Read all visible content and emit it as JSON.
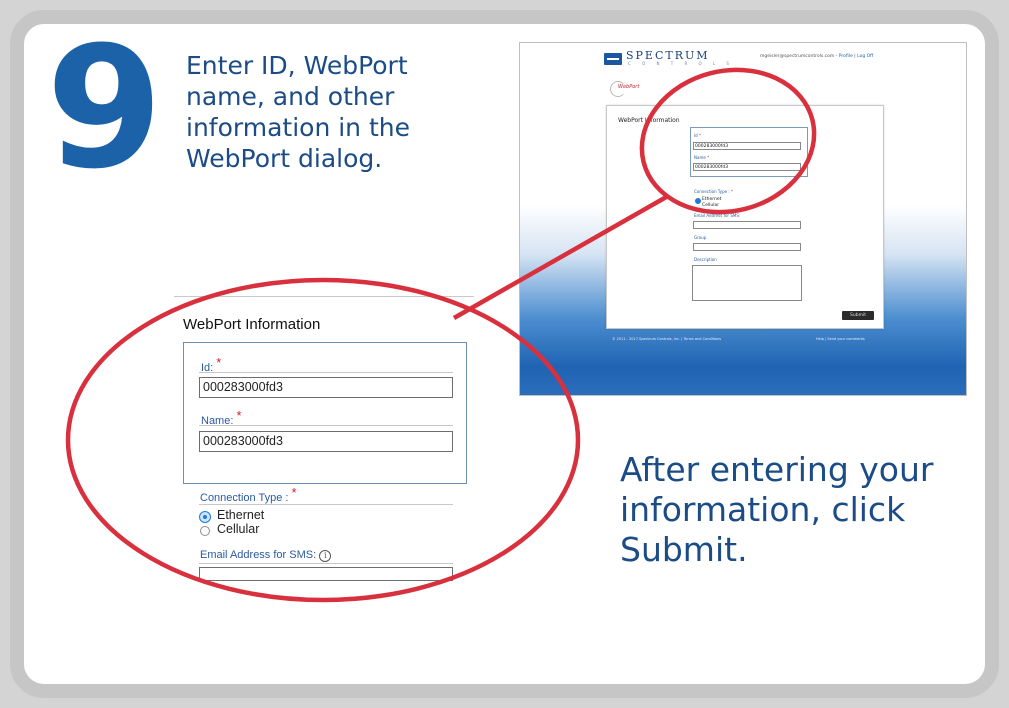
{
  "step": {
    "number": "9",
    "instruction": "Enter ID, WebPort name, and other information in the WebPort dialog.",
    "after_text": "After entering your information, click Submit."
  },
  "colors": {
    "accent": "#1b62a8",
    "text_blue": "#1b4c86",
    "highlight_ring": "#d9303d",
    "card_border": "#c6c6c6"
  },
  "screenshot": {
    "brand": "SPECTRUM",
    "brand_sub": "C O N T R O L S",
    "header_user": "mgeisler@spectrumcontrols.com",
    "header_profile": "Profile",
    "header_logoff": "Log Off",
    "product_logo": "WebPort",
    "panel_title": "WebPort Information",
    "id_label": "Id",
    "id_value": "000283000fd3",
    "name_label": "Name",
    "name_value": "000283000fd3",
    "connection_label": "Connection Type :",
    "option_ethernet": "Ethernet",
    "option_cellular": "Cellular",
    "email_label": "Email Address for SMS:",
    "group_label": "Group",
    "description_label": "Description",
    "submit_label": "Submit",
    "footer_left": "© 2011 - 2017 Spectrum Controls, Inc. | Terms and Conditions",
    "footer_right": "Help | Send your comments"
  },
  "zoom": {
    "panel_title": "WebPort Information",
    "id_label": "Id:",
    "id_value": "000283000fd3",
    "name_label": "Name:",
    "name_value": "000283000fd3",
    "connection_label": "Connection Type :",
    "option_ethernet": "Ethernet",
    "option_cellular": "Cellular",
    "email_label": "Email Address for SMS:",
    "required_mark": "*",
    "info_icon": "info-icon",
    "selected_option": "Ethernet"
  }
}
